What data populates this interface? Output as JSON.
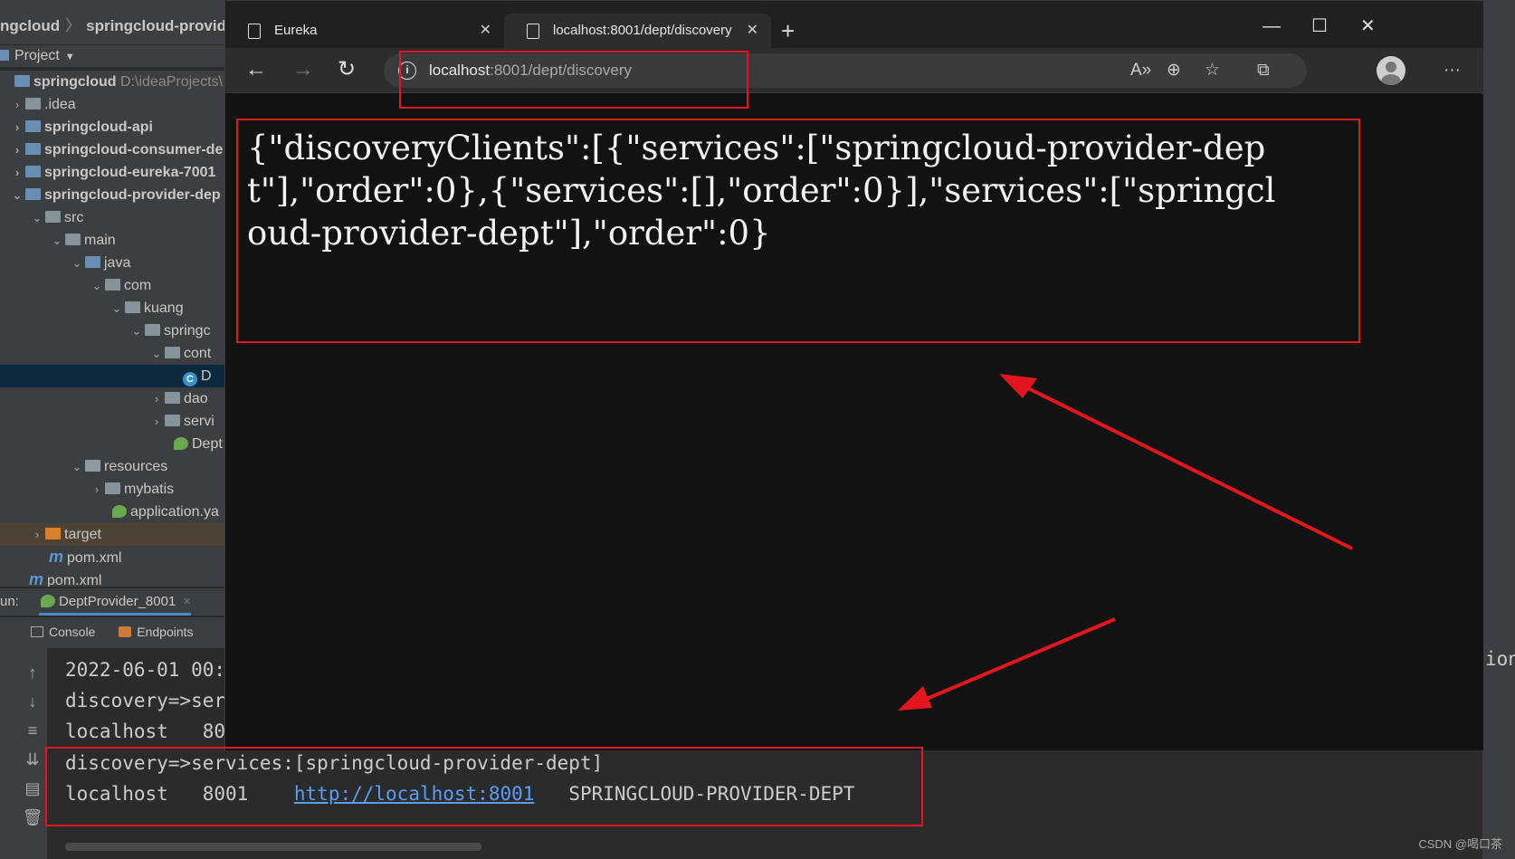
{
  "ide": {
    "breadcrumb": {
      "root": "ngcloud",
      "module": "springcloud-provider-"
    },
    "project_panel": {
      "title": "Project"
    },
    "tree": [
      {
        "label": "springcloud",
        "extra": "D:\\ideaProjects\\",
        "icon": "module-folder-icon"
      },
      {
        "label": ".idea",
        "icon": "folder-icon"
      },
      {
        "label": "springcloud-api",
        "icon": "module-folder-icon"
      },
      {
        "label": "springcloud-consumer-de",
        "icon": "module-folder-icon"
      },
      {
        "label": "springcloud-eureka-7001",
        "icon": "module-folder-icon"
      },
      {
        "label": "springcloud-provider-dep",
        "icon": "module-folder-icon"
      },
      {
        "label": "src",
        "icon": "folder-icon"
      },
      {
        "label": "main",
        "icon": "folder-icon"
      },
      {
        "label": "java",
        "icon": "source-folder-icon"
      },
      {
        "label": "com",
        "icon": "package-icon"
      },
      {
        "label": "kuang",
        "icon": "package-icon"
      },
      {
        "label": "springc",
        "icon": "package-icon"
      },
      {
        "label": "cont",
        "icon": "package-icon"
      },
      {
        "label": "D",
        "icon": "class-icon"
      },
      {
        "label": "dao",
        "icon": "package-icon"
      },
      {
        "label": "servi",
        "icon": "package-icon"
      },
      {
        "label": "Dept",
        "icon": "spring-boot-icon"
      },
      {
        "label": "resources",
        "icon": "resources-folder-icon"
      },
      {
        "label": "mybatis",
        "icon": "folder-icon"
      },
      {
        "label": "application.ya",
        "icon": "spring-config-icon"
      },
      {
        "label": "target",
        "icon": "excluded-folder-icon"
      },
      {
        "label": "pom.xml",
        "icon": "maven-icon"
      },
      {
        "label": "pom.xml",
        "icon": "maven-icon"
      }
    ],
    "run": {
      "prefix": "un:",
      "config": "DeptProvider_8001"
    },
    "console_tabs": [
      "Console",
      "Endpoints"
    ],
    "console_lines": [
      "2022-06-01 00:",
      "discovery=>ser",
      "localhost   80",
      "discovery=>services:[springcloud-provider-dept]"
    ],
    "instance_row": {
      "host": "localhost",
      "port": "8001",
      "uri": "http://localhost:8001",
      "service_id": "SPRINGCLOUD-PROVIDER-DEPT"
    },
    "right_fragment": "ion"
  },
  "browser": {
    "tabs": [
      {
        "title": "Eureka",
        "active": false
      },
      {
        "title": "localhost:8001/dept/discovery",
        "active": true
      }
    ],
    "address": {
      "host": "localhost",
      "rest": ":8001/dept/discovery"
    },
    "body_text": "{\"discoveryClients\":[{\"services\":[\"springcloud-provider-dept\"],\"order\":0},{\"services\":[],\"order\":0}],\"services\":[\"springcloud-provider-dept\"],\"order\":0}"
  },
  "watermark": "CSDN @喝口茶",
  "colors": {
    "annotation": "#e3161f",
    "link": "#589df6",
    "ide_bg": "#2b2b2b",
    "browser_bg": "#121212"
  }
}
